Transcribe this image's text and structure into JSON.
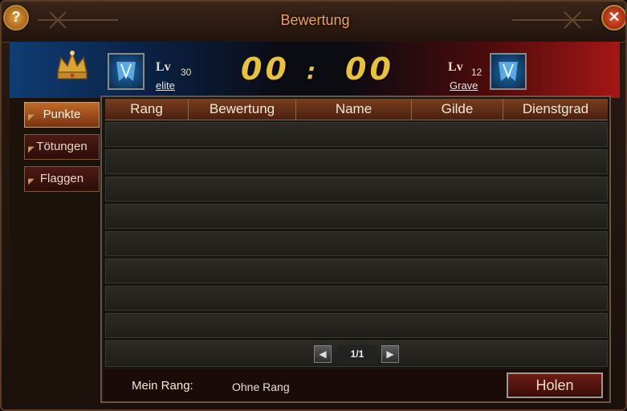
{
  "window": {
    "title": "Bewertung",
    "help_label": "?",
    "close_label": "✕"
  },
  "players": {
    "left": {
      "lv_label": "Lv",
      "level": "30",
      "name": "elite"
    },
    "right": {
      "lv_label": "Lv",
      "level": "12",
      "name": "Grave"
    }
  },
  "score": {
    "left": "00",
    "separator": ":",
    "right": "00"
  },
  "tabs": [
    {
      "label": "Punkte",
      "active": true
    },
    {
      "label": "Tötungen",
      "active": false
    },
    {
      "label": "Flaggen",
      "active": false
    }
  ],
  "table": {
    "headers": [
      "Rang",
      "Bewertung",
      "Name",
      "Gilde",
      "Dienstgrad"
    ],
    "rows": [],
    "empty_row_count": 8
  },
  "pagination": {
    "prev_icon": "chevron-left-icon",
    "next_icon": "chevron-right-icon",
    "text": "1/1"
  },
  "footer": {
    "my_rank_label": "Mein Rang:",
    "my_rank_value": "Ohne Rang",
    "fetch_button": "Holen"
  },
  "colors": {
    "title": "#f0a050",
    "score": "#e8c238",
    "active_tab": "#c06a28",
    "left_side": "#0f3d74",
    "right_side": "#a61616"
  }
}
